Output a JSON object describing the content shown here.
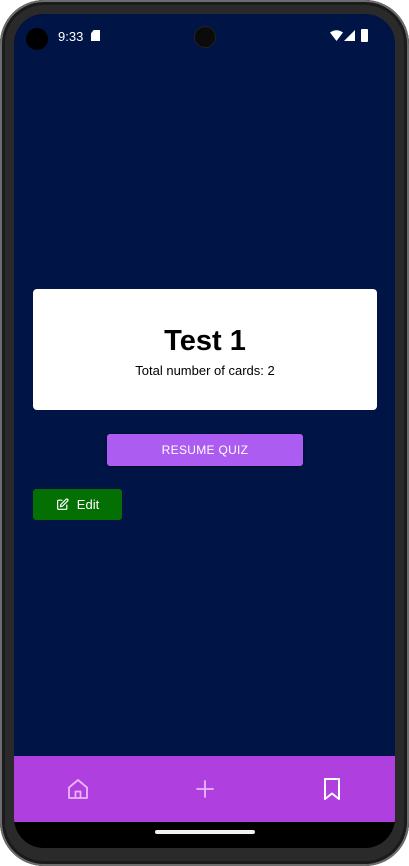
{
  "status_bar": {
    "time": "9:33",
    "icons": [
      "sd-card-icon",
      "wifi-icon",
      "signal-icon",
      "battery-icon"
    ]
  },
  "deck": {
    "title": "Test 1",
    "card_count_text": "Total number of cards: 2"
  },
  "actions": {
    "resume_label": "RESUME QUIZ",
    "edit_label": "Edit",
    "edit_icon": "edit-icon"
  },
  "bottom_nav": {
    "items": [
      {
        "icon": "home-icon"
      },
      {
        "icon": "plus-icon"
      },
      {
        "icon": "bookmark-icon"
      }
    ]
  },
  "colors": {
    "background": "#001445",
    "card": "#ffffff",
    "resume_button": "#ad5cf2",
    "edit_button": "#047004",
    "bottom_nav": "#b03fe0",
    "nav_icon": "#e9b7f8"
  }
}
